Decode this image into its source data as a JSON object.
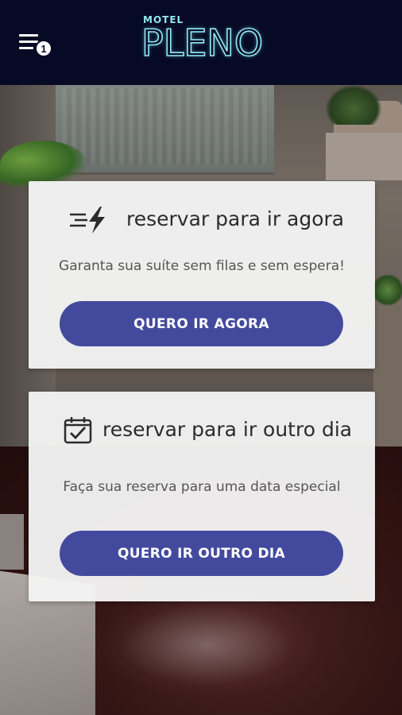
{
  "header": {
    "logo_small": "MOTEL",
    "logo_big": "PLENO",
    "menu_icon": "menu-icon",
    "notification_count": "1",
    "background_color": "#070a24",
    "logo_color": "#8fe8f2"
  },
  "cards": [
    {
      "icon": "fast-lightning-icon",
      "title": "reservar para ir agora",
      "subtitle": "Garanta sua suíte sem filas e sem espera!",
      "button_label": "QUERO IR AGORA"
    },
    {
      "icon": "calendar-check-icon",
      "title": "reservar para ir outro dia",
      "subtitle": "Faça sua reserva para uma data especial",
      "button_label": "QUERO IR OUTRO DIA"
    }
  ],
  "colors": {
    "button": "#434a9e",
    "card": "#f4f4f4",
    "text": "#2b2b2b"
  }
}
